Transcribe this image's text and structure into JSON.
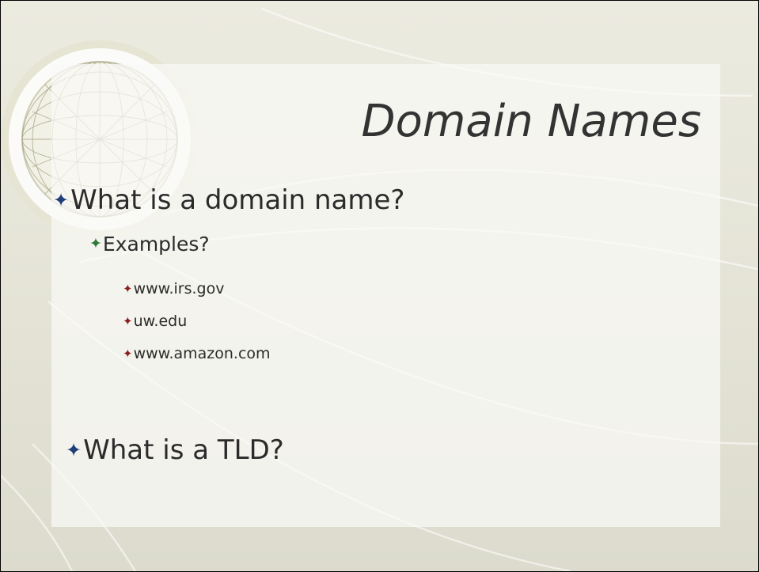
{
  "slide": {
    "title": "Domain Names",
    "bullets": {
      "what_is_domain": "What is a domain name?",
      "examples": "Examples?",
      "example_items": [
        "www.irs.gov",
        "uw.edu",
        "www.amazon.com"
      ],
      "what_is_tld": "What is a TLD?"
    },
    "bullet_icons": {
      "level1": "four-point-star-icon",
      "level2": "four-point-star-icon",
      "level3": "four-point-star-icon"
    },
    "colors": {
      "title_text": "#333333",
      "body_text": "#2b2b2b",
      "level1_bullet": "#1f3e7a",
      "level2_bullet": "#2d7a38",
      "level3_bullet": "#8a1e1e",
      "background": "#e4e3d6"
    }
  }
}
